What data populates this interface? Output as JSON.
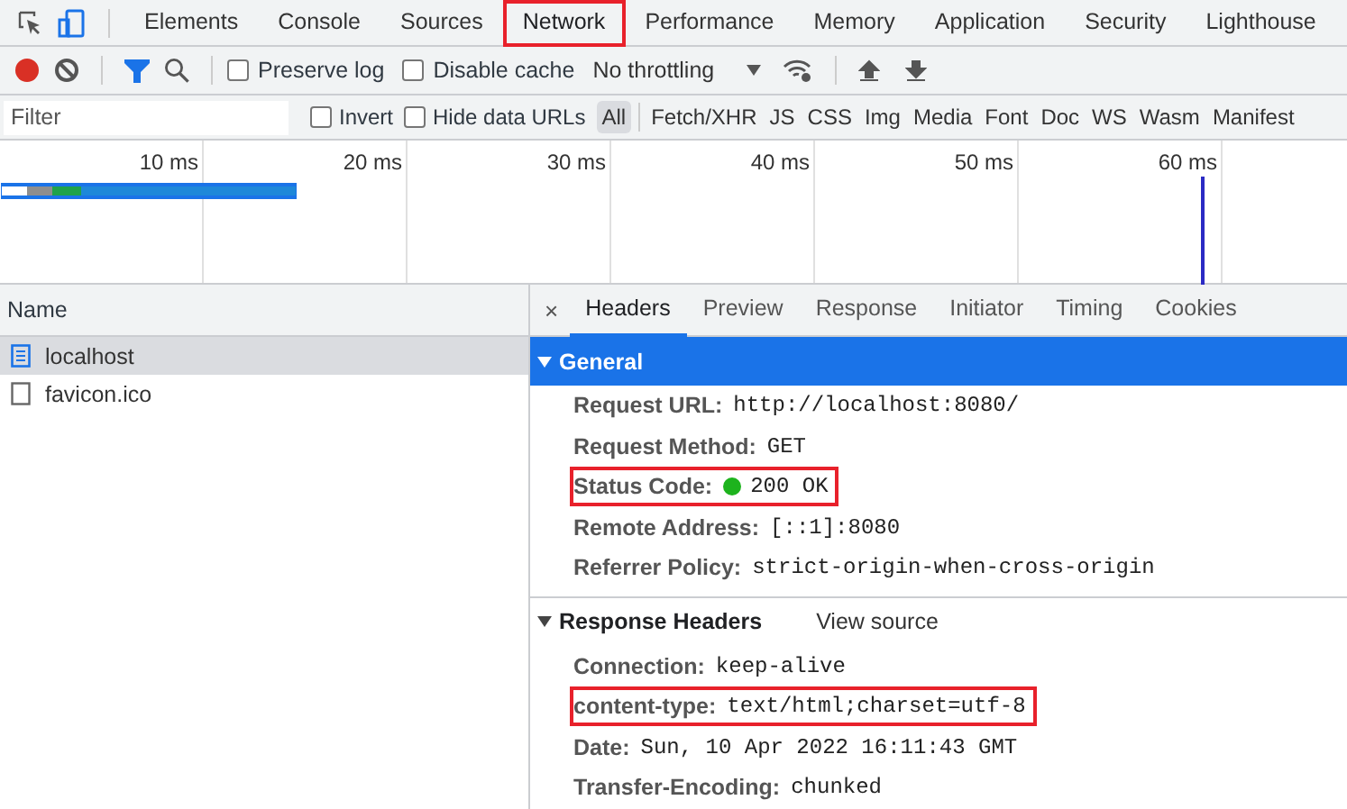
{
  "main_tabs": [
    {
      "label": "Elements",
      "selected": false,
      "highlighted": false
    },
    {
      "label": "Console",
      "selected": false,
      "highlighted": false
    },
    {
      "label": "Sources",
      "selected": false,
      "highlighted": false
    },
    {
      "label": "Network",
      "selected": true,
      "highlighted": true
    },
    {
      "label": "Performance",
      "selected": false,
      "highlighted": false
    },
    {
      "label": "Memory",
      "selected": false,
      "highlighted": false
    },
    {
      "label": "Application",
      "selected": false,
      "highlighted": false
    },
    {
      "label": "Security",
      "selected": false,
      "highlighted": false
    },
    {
      "label": "Lighthouse",
      "selected": false,
      "highlighted": false
    }
  ],
  "device_toolbar_on": true,
  "toolbar": {
    "recording": true,
    "filter_on": true,
    "checkboxes": [
      {
        "label": "Preserve log",
        "checked": false
      },
      {
        "label": "Disable cache",
        "checked": false
      }
    ],
    "throttling": "No throttling"
  },
  "filter_bar": {
    "placeholder": "Filter",
    "checkboxes": [
      {
        "label": "Invert",
        "checked": false
      },
      {
        "label": "Hide data URLs",
        "checked": false
      }
    ],
    "types": [
      {
        "label": "All",
        "selected": true
      },
      {
        "label": "Fetch/XHR",
        "selected": false
      },
      {
        "label": "JS",
        "selected": false
      },
      {
        "label": "CSS",
        "selected": false
      },
      {
        "label": "Img",
        "selected": false
      },
      {
        "label": "Media",
        "selected": false
      },
      {
        "label": "Font",
        "selected": false
      },
      {
        "label": "Doc",
        "selected": false
      },
      {
        "label": "WS",
        "selected": false
      },
      {
        "label": "Wasm",
        "selected": false
      },
      {
        "label": "Manifest",
        "selected": false
      }
    ]
  },
  "timeline_ticks": [
    "10 ms",
    "20 ms",
    "30 ms",
    "40 ms",
    "50 ms",
    "60 ms"
  ],
  "requests": {
    "column": "Name",
    "rows": [
      {
        "name": "localhost",
        "kind": "document",
        "selected": true
      },
      {
        "name": "favicon.ico",
        "kind": "file",
        "selected": false
      }
    ]
  },
  "detail": {
    "close": "×",
    "tabs": [
      {
        "label": "Headers",
        "selected": true
      },
      {
        "label": "Preview",
        "selected": false
      },
      {
        "label": "Response",
        "selected": false
      },
      {
        "label": "Initiator",
        "selected": false
      },
      {
        "label": "Timing",
        "selected": false
      },
      {
        "label": "Cookies",
        "selected": false
      }
    ],
    "sections": [
      {
        "title": "General",
        "expanded": true,
        "selected": true,
        "rows": [
          {
            "key": "Request URL:",
            "value": "http://localhost:8080/",
            "highlighted": false
          },
          {
            "key": "Request Method:",
            "value": "GET",
            "highlighted": false
          },
          {
            "key": "Status Code:",
            "value": "200 OK",
            "color": "#1db31d",
            "highlighted": true
          },
          {
            "key": "Remote Address:",
            "value": "[::1]:8080",
            "highlighted": false
          },
          {
            "key": "Referrer Policy:",
            "value": "strict-origin-when-cross-origin",
            "highlighted": false
          }
        ]
      },
      {
        "title": "Response Headers",
        "expanded": true,
        "selected": false,
        "link": "View source",
        "rows": [
          {
            "key": "Connection:",
            "value": "keep-alive",
            "highlighted": false
          },
          {
            "key": "content-type:",
            "value": "text/html;charset=utf-8",
            "highlighted": true
          },
          {
            "key": "Date:",
            "value": "Sun, 10 Apr 2022 16:11:43 GMT",
            "highlighted": false
          },
          {
            "key": "Transfer-Encoding:",
            "value": "chunked",
            "highlighted": false
          }
        ]
      }
    ]
  }
}
